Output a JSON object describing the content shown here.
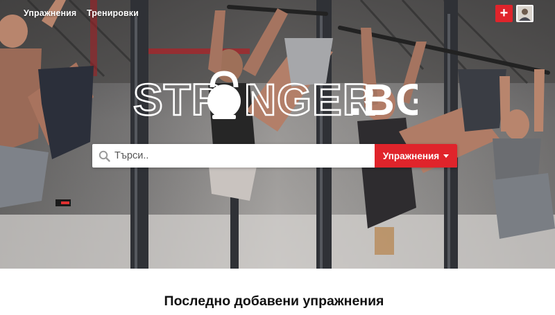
{
  "nav": {
    "items": [
      {
        "label": "Упражнения"
      },
      {
        "label": "Тренировки"
      }
    ],
    "add_label": "+",
    "accent": "#e0242b"
  },
  "hero": {
    "logo_text": "STRONGER.BG",
    "search": {
      "placeholder": "Търси..",
      "value": "",
      "icon": "search-icon",
      "category_label": "Упражнения"
    }
  },
  "section": {
    "title": "Последно добавени упражнения"
  }
}
